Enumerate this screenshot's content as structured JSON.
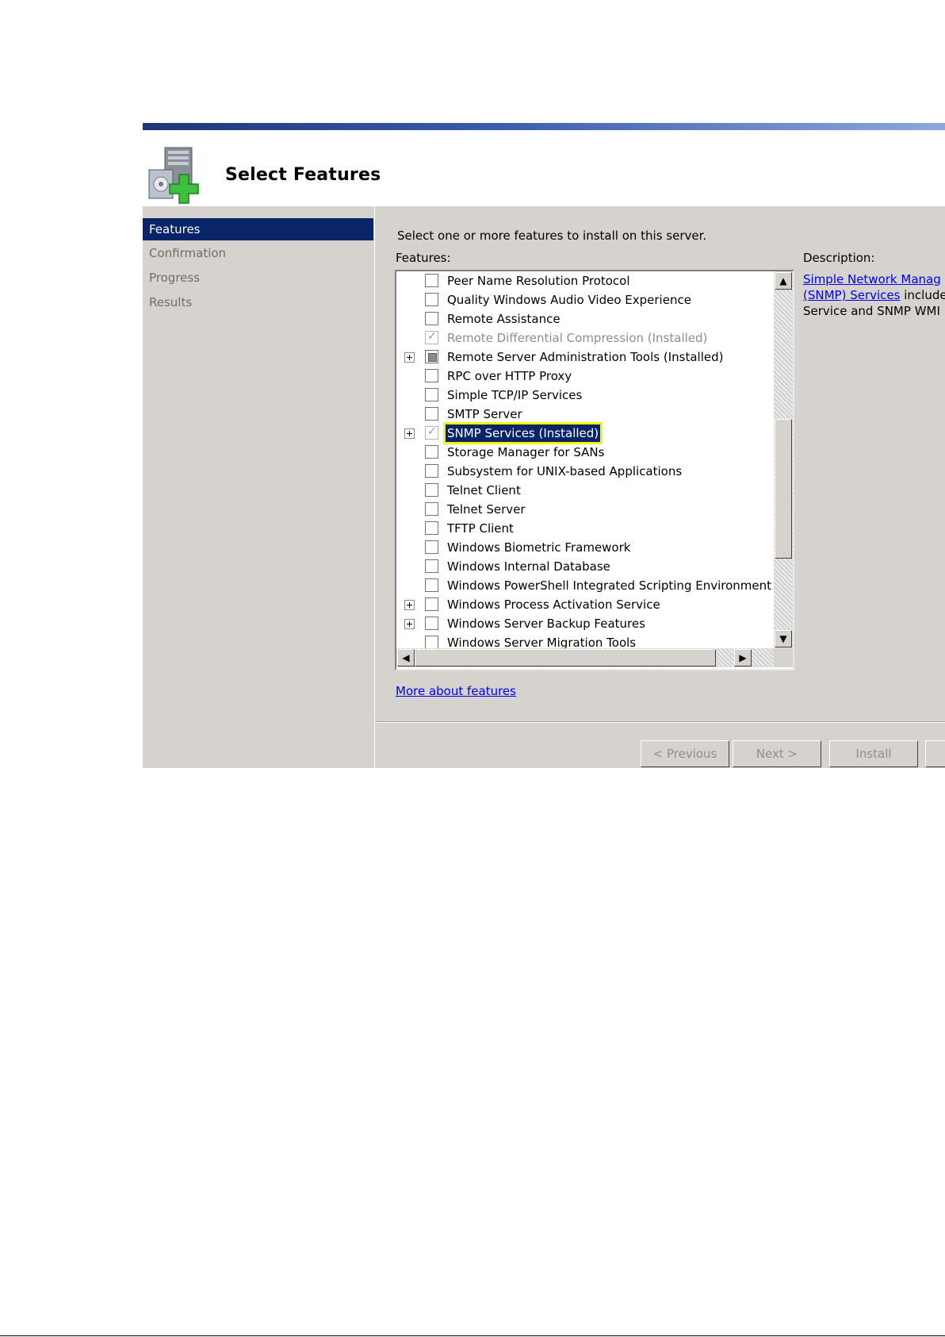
{
  "header": {
    "title": "Select Features"
  },
  "nav": {
    "items": [
      {
        "label": "Features",
        "active": true
      },
      {
        "label": "Confirmation",
        "active": false
      },
      {
        "label": "Progress",
        "active": false
      },
      {
        "label": "Results",
        "active": false
      }
    ]
  },
  "main": {
    "instruction": "Select one or more features to install on this server.",
    "features_label": "Features:",
    "description_label": "Description:",
    "description": {
      "link_line1": "Simple Network Manag",
      "link_line2": "(SNMP) Services",
      "text_after_link": " include",
      "line3": "Service and SNMP WMI"
    },
    "features": [
      {
        "label": "Peer Name Resolution Protocol",
        "state": "unchecked",
        "expander": false
      },
      {
        "label": "Quality Windows Audio Video Experience",
        "state": "unchecked",
        "expander": false
      },
      {
        "label": "Remote Assistance",
        "state": "unchecked",
        "expander": false
      },
      {
        "label": "Remote Differential Compression  (Installed)",
        "state": "checked-disabled",
        "expander": false
      },
      {
        "label": "Remote Server Administration Tools  (Installed)",
        "state": "partial",
        "expander": true
      },
      {
        "label": "RPC over HTTP Proxy",
        "state": "unchecked",
        "expander": false
      },
      {
        "label": "Simple TCP/IP Services",
        "state": "unchecked",
        "expander": false
      },
      {
        "label": "SMTP Server",
        "state": "unchecked",
        "expander": false
      },
      {
        "label": "SNMP Services  (Installed)",
        "state": "checked-disabled",
        "expander": true,
        "selected": true
      },
      {
        "label": "Storage Manager for SANs",
        "state": "unchecked",
        "expander": false
      },
      {
        "label": "Subsystem for UNIX-based Applications",
        "state": "unchecked",
        "expander": false
      },
      {
        "label": "Telnet Client",
        "state": "unchecked",
        "expander": false
      },
      {
        "label": "Telnet Server",
        "state": "unchecked",
        "expander": false
      },
      {
        "label": "TFTP Client",
        "state": "unchecked",
        "expander": false
      },
      {
        "label": "Windows Biometric Framework",
        "state": "unchecked",
        "expander": false
      },
      {
        "label": "Windows Internal Database",
        "state": "unchecked",
        "expander": false
      },
      {
        "label": "Windows PowerShell Integrated Scripting Environment (IS",
        "state": "unchecked",
        "expander": false
      },
      {
        "label": "Windows Process Activation Service",
        "state": "unchecked",
        "expander": true
      },
      {
        "label": "Windows Server Backup Features",
        "state": "unchecked",
        "expander": true
      },
      {
        "label": "Windows Server Migration Tools",
        "state": "unchecked",
        "expander": false
      }
    ],
    "more_link": "More about features"
  },
  "buttons": {
    "previous": "< Previous",
    "next": "Next >",
    "install": "Install"
  },
  "colors": {
    "selection": "#0a246a",
    "highlight": "#f6f600",
    "panel": "#d6d3ce"
  }
}
